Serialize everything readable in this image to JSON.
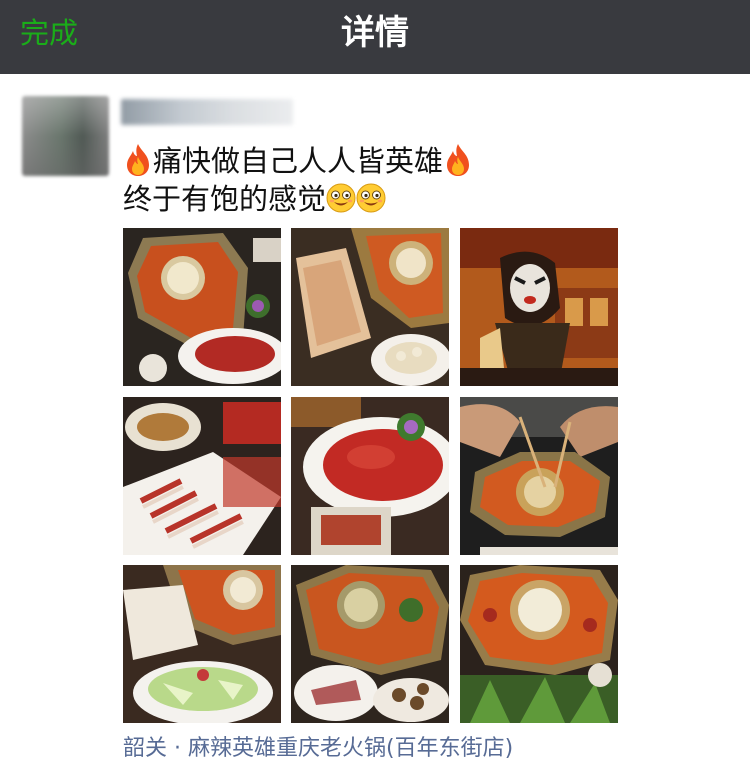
{
  "navbar": {
    "done_label": "完成",
    "title": "详情"
  },
  "post": {
    "text_line1": "痛快做自己人人皆英雄",
    "text_line2": "终于有饱的感觉",
    "emoji": {
      "line1_prefix": "fire-icon",
      "line1_suffix": "fire-icon",
      "line2_suffix": [
        "smiling-face-icon",
        "smiling-face-icon"
      ]
    },
    "photos": [
      {
        "subject": "octagonal-hotpot-with-meat-plate"
      },
      {
        "subject": "tofu-skin-and-hotpot"
      },
      {
        "subject": "opera-mask-mural"
      },
      {
        "subject": "sliced-beef-and-lamb-plates"
      },
      {
        "subject": "marinated-beef-plate"
      },
      {
        "subject": "diners-dipping-in-hotpot"
      },
      {
        "subject": "hotpot-with-greens"
      },
      {
        "subject": "hotpot-with-fish-slices"
      },
      {
        "subject": "hotpot-with-vegetables"
      }
    ],
    "location": "韶关 · 麻辣英雄重庆老火锅(百年东街店)"
  },
  "colors": {
    "navbar_bg": "#393a3f",
    "done_text": "#1aad19",
    "link_blue": "#576b95"
  }
}
